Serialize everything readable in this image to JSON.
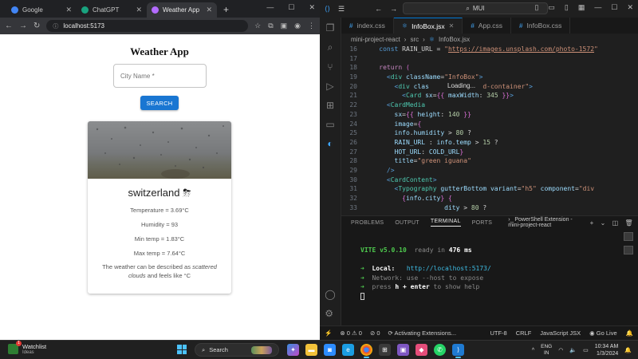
{
  "browser": {
    "tabs": [
      {
        "label": "Google",
        "color": "#4285f4"
      },
      {
        "label": "ChatGPT",
        "color": "#19a37f"
      },
      {
        "label": "Weather App",
        "color": "#b36bff"
      }
    ],
    "url": "localhost:5173",
    "page": {
      "title": "Weather App",
      "city_placeholder": "City Name *",
      "search_label": "SEARCH",
      "card": {
        "city": "switzerland",
        "weather_icon": "⛈",
        "temperature": "Temperature = 3.69°C",
        "humidity": "Humidity = 93",
        "min_temp": "Min temp = 1.83°C",
        "max_temp": "Max temp = 7.64°C",
        "desc_prefix": "The weather can be described as ",
        "desc_italic": "scattered clouds",
        "desc_suffix": " and feels like °C"
      }
    }
  },
  "vscode": {
    "search": "MUI",
    "tabs": [
      "index.css",
      "InfoBox.jsx",
      "App.css",
      "InfoBox.css"
    ],
    "active_tab": 1,
    "breadcrumb": [
      "mini-project-react",
      "src",
      "InfoBox.jsx"
    ],
    "loading_text": "Loading...",
    "code_lines": [
      {
        "n": "16",
        "html": "    <span class='kw'>const</span> RAIN_URL = <span class='st'>\"<u>https://images.unsplash.com/photo-1572</u>\"</span>"
      },
      {
        "n": "17",
        "html": ""
      },
      {
        "n": "18",
        "html": "    <span class='pl'>return</span> <span class='br'>(</span>"
      },
      {
        "n": "19",
        "html": "      <span class='kw'>&lt;</span><span class='tg'>div</span> <span class='at'>className</span>=<span class='st'>\"InfoBox\"</span><span class='kw'>&gt;</span>"
      },
      {
        "n": "20",
        "html": "        <span class='kw'>&lt;</span><span class='tg'>div</span> <span class='at'>clas</span>              <span class='st'>d-container\"</span><span class='kw'>&gt;</span>"
      },
      {
        "n": "21",
        "html": "          <span class='kw'>&lt;</span><span class='tg'>Card</span> <span class='at'>sx</span>=<span class='br'>{{</span> <span class='at'>maxWidth</span>: <span class='nu'>345</span> <span class='br'>}}</span><span class='kw'>&gt;</span>"
      },
      {
        "n": "22",
        "html": "      <span class='kw'>&lt;</span><span class='tg'>CardMedia</span>"
      },
      {
        "n": "23",
        "html": "        <span class='at'>sx</span>=<span class='br'>{{</span> <span class='at'>height</span>: <span class='nu'>140</span> <span class='br'>}}</span>"
      },
      {
        "n": "24",
        "html": "        <span class='at'>image</span>=<span class='br'>{</span>"
      },
      {
        "n": "25",
        "html": "        <span class='at'>info</span>.<span class='at'>humidity</span> &gt; <span class='nu'>80</span> ?"
      },
      {
        "n": "26",
        "html": "        <span class='at'>RAIN_URL</span> : <span class='at'>info</span>.<span class='at'>temp</span> &gt; <span class='nu'>15</span> ?"
      },
      {
        "n": "27",
        "html": "        <span class='at'>HOT_URL</span>: <span class='at'>COLD_URL</span><span class='br'>}</span>"
      },
      {
        "n": "28",
        "html": "        <span class='at'>title</span>=<span class='st'>\"green iguana\"</span>"
      },
      {
        "n": "29",
        "html": "      <span class='kw'>/&gt;</span>"
      },
      {
        "n": "30",
        "html": "      <span class='kw'>&lt;</span><span class='tg'>CardContent</span><span class='kw'>&gt;</span>"
      },
      {
        "n": "31",
        "html": "        <span class='kw'>&lt;</span><span class='tg'>Typography</span> <span class='at'>gutterBottom</span> <span class='at'>variant</span>=<span class='st'>\"h5\"</span> <span class='at'>component</span>=<span class='st'>\"div</span>"
      },
      {
        "n": "32",
        "html": "          <span class='br'>{</span><span class='at'>info</span>.<span class='at'>city</span><span class='br'>}</span> <span class='br'>{</span>"
      },
      {
        "n": "33",
        "html": "                     <span class='at'>dity</span> &gt; <span class='nu'>80</span> ?"
      }
    ],
    "panel_tabs": [
      "PROBLEMS",
      "OUTPUT",
      "TERMINAL",
      "PORTS"
    ],
    "active_panel_tab": 2,
    "terminal_name": "PowerShell Extension - mini-project-react",
    "terminal": {
      "vite": "VITE v5.0.10",
      "ready": "ready in",
      "ready_ms": "476 ms",
      "local_label": "Local:",
      "local_url": "http://localhost:5173/",
      "network": "Network: use --host to expose",
      "help_prefix": "press ",
      "help_key": "h + enter",
      "help_suffix": " to show help"
    },
    "status": {
      "errors": "0",
      "warnings": "0",
      "ports": "0",
      "activity": "Activating Extensions...",
      "encoding": "UTF-8",
      "eol": "CRLF",
      "language": "JavaScript JSX",
      "golive": "Go Live"
    }
  },
  "taskbar": {
    "widget_title": "Watchlist",
    "widget_sub": "Ideas",
    "search": "Search",
    "lang_top": "ENG",
    "lang_bottom": "IN",
    "time": "10:34 AM",
    "date": "1/3/2024"
  }
}
